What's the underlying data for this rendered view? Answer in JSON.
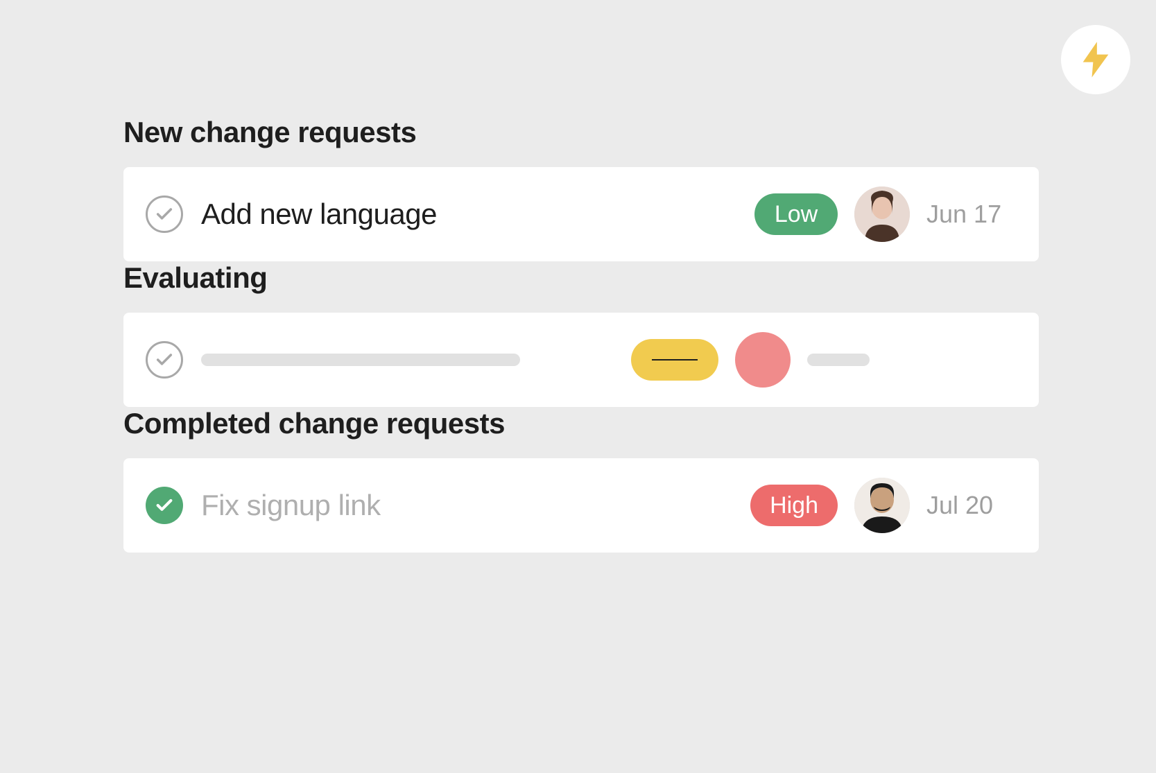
{
  "automation_icon": "lightning-bolt-icon",
  "sections": [
    {
      "title": "New change requests",
      "task": {
        "title": "Add new language",
        "completed": false,
        "priority": {
          "label": "Low",
          "color": "low"
        },
        "assignee": "avatar-person-1",
        "due": "Jun 17"
      }
    },
    {
      "title": "Evaluating",
      "task": {
        "title": null,
        "completed": false,
        "priority": {
          "label": null,
          "color": "placeholder"
        },
        "assignee": "avatar-placeholder",
        "due": null
      }
    },
    {
      "title": "Completed change requests",
      "task": {
        "title": "Fix signup link",
        "completed": true,
        "priority": {
          "label": "High",
          "color": "high"
        },
        "assignee": "avatar-person-2",
        "due": "Jul 20"
      }
    }
  ]
}
